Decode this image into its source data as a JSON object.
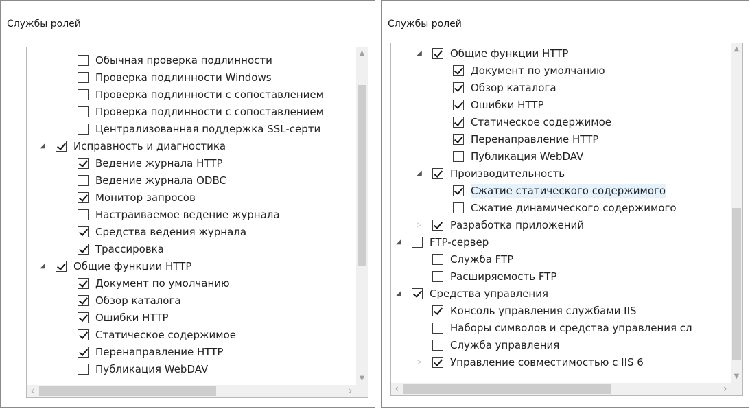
{
  "left_panel": {
    "title": "Службы ролей",
    "items": [
      {
        "label": "Обычная проверка подлинности",
        "checked": false,
        "level": 2,
        "arrow": "none"
      },
      {
        "label": "Проверка подлинности Windows",
        "checked": false,
        "level": 2,
        "arrow": "none"
      },
      {
        "label": "Проверка подлинности с сопоставлением",
        "checked": false,
        "level": 2,
        "arrow": "none"
      },
      {
        "label": "Проверка подлинности с сопоставлением",
        "checked": false,
        "level": 2,
        "arrow": "none"
      },
      {
        "label": "Централизованная поддержка SSL-серти",
        "checked": false,
        "level": 2,
        "arrow": "none"
      },
      {
        "label": "Исправность и диагностика",
        "checked": true,
        "level": 1,
        "arrow": "expanded"
      },
      {
        "label": "Ведение журнала HTTP",
        "checked": true,
        "level": 2,
        "arrow": "none"
      },
      {
        "label": "Ведение журнала ODBC",
        "checked": false,
        "level": 2,
        "arrow": "none"
      },
      {
        "label": "Монитор запросов",
        "checked": true,
        "level": 2,
        "arrow": "none"
      },
      {
        "label": "Настраиваемое ведение журнала",
        "checked": false,
        "level": 2,
        "arrow": "none"
      },
      {
        "label": "Средства ведения журнала",
        "checked": true,
        "level": 2,
        "arrow": "none"
      },
      {
        "label": "Трассировка",
        "checked": true,
        "level": 2,
        "arrow": "none"
      },
      {
        "label": "Общие функции HTTP",
        "checked": true,
        "level": 1,
        "arrow": "expanded"
      },
      {
        "label": "Документ по умолчанию",
        "checked": true,
        "level": 2,
        "arrow": "none"
      },
      {
        "label": "Обзор каталога",
        "checked": true,
        "level": 2,
        "arrow": "none"
      },
      {
        "label": "Ошибки HTTP",
        "checked": true,
        "level": 2,
        "arrow": "none"
      },
      {
        "label": "Статическое содержимое",
        "checked": true,
        "level": 2,
        "arrow": "none"
      },
      {
        "label": "Перенаправление HTTP",
        "checked": true,
        "level": 2,
        "arrow": "none"
      },
      {
        "label": "Публикация WebDAV",
        "checked": false,
        "level": 2,
        "arrow": "none"
      }
    ],
    "vscroll": {
      "up_icon": "▲",
      "down_icon": "▼",
      "position": 0.35
    },
    "hscroll": {
      "left_icon": "‹",
      "right_icon": "›"
    }
  },
  "right_panel": {
    "title": "Службы ролей",
    "items": [
      {
        "label": "Общие функции HTTP",
        "checked": true,
        "level": 1,
        "arrow": "expanded"
      },
      {
        "label": "Документ по умолчанию",
        "checked": true,
        "level": 2,
        "arrow": "none"
      },
      {
        "label": "Обзор каталога",
        "checked": true,
        "level": 2,
        "arrow": "none"
      },
      {
        "label": "Ошибки HTTP",
        "checked": true,
        "level": 2,
        "arrow": "none"
      },
      {
        "label": "Статическое содержимое",
        "checked": true,
        "level": 2,
        "arrow": "none"
      },
      {
        "label": "Перенаправление HTTP",
        "checked": true,
        "level": 2,
        "arrow": "none"
      },
      {
        "label": "Публикация WebDAV",
        "checked": false,
        "level": 2,
        "arrow": "none"
      },
      {
        "label": "Производительность",
        "checked": true,
        "level": 1,
        "arrow": "expanded"
      },
      {
        "label": "Сжатие статического содержимого",
        "checked": true,
        "level": 2,
        "arrow": "none",
        "highlighted": true
      },
      {
        "label": "Сжатие динамического содержимого",
        "checked": false,
        "level": 2,
        "arrow": "none"
      },
      {
        "label": "Разработка приложений",
        "checked": true,
        "level": 1,
        "arrow": "collapsed"
      },
      {
        "label": "FTP-сервер",
        "checked": false,
        "level": 0,
        "arrow": "expanded"
      },
      {
        "label": "Служба FTP",
        "checked": false,
        "level": 1,
        "arrow": "none"
      },
      {
        "label": "Расширяемость FTP",
        "checked": false,
        "level": 1,
        "arrow": "none"
      },
      {
        "label": "Средства управления",
        "checked": true,
        "level": 0,
        "arrow": "expanded"
      },
      {
        "label": "Консоль управления службами IIS",
        "checked": true,
        "level": 1,
        "arrow": "none"
      },
      {
        "label": "Наборы символов и средства управления сл",
        "checked": false,
        "level": 1,
        "arrow": "none"
      },
      {
        "label": "Служба управления",
        "checked": false,
        "level": 1,
        "arrow": "none"
      },
      {
        "label": "Управление совместимостью с IIS 6",
        "checked": true,
        "level": 1,
        "arrow": "collapsed"
      }
    ],
    "vscroll": {
      "up_icon": "▲",
      "down_icon": "▼",
      "position": 0.85
    },
    "hscroll": {
      "left_icon": "‹",
      "right_icon": "›"
    }
  },
  "icons": {
    "expanded": "◢",
    "collapsed": "▷"
  }
}
